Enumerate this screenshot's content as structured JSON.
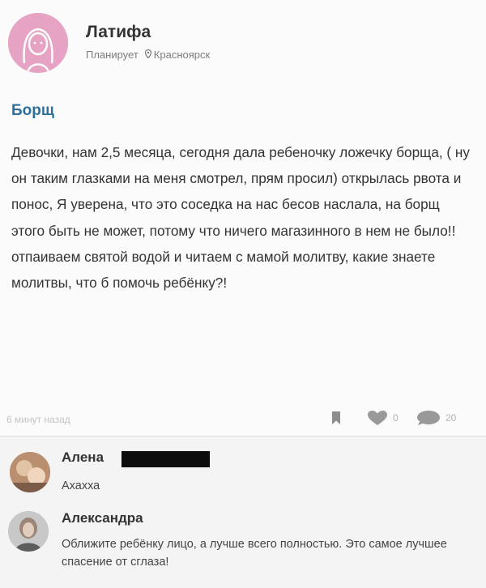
{
  "post": {
    "author": {
      "name": "Латифа",
      "status": "Планирует",
      "location": "Красноярск"
    },
    "title": "Борщ",
    "body": "Девочки, нам 2,5 месяца, сегодня дала ребеночку ложечку борща, ( ну он таким глазками на меня смотрел, прям просил) открылась рвота и понос, Я уверена, что это соседка на нас бесов наслала, на борщ этого быть не может, потому что ничего магазинного в нем не было!! отпаиваем святой водой и читаем с мамой молитву, какие знаете молитвы, что б помочь ребёнку?!",
    "time": "6 минут назад",
    "stats": {
      "likes": "0",
      "comments": "20"
    }
  },
  "comments": [
    {
      "name": "Алена",
      "text": "Ахахха"
    },
    {
      "name": "Александра",
      "text": "Оближите ребёнку лицо, а лучше всего полностью. Это самое лучшее спасение от сглаза!"
    }
  ],
  "colors": {
    "title": "#2b6f9a",
    "avatar_bg": "#e7a3c4",
    "comments_bg": "#f4f4f4"
  },
  "icons": [
    "pin-icon",
    "bookmark-icon",
    "heart-icon",
    "comment-bubble-icon"
  ]
}
